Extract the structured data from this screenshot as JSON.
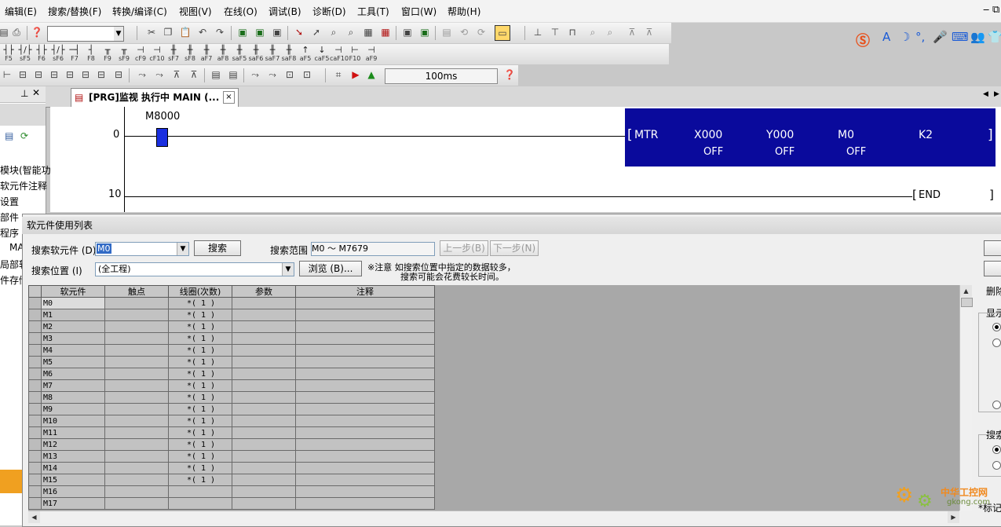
{
  "menu": [
    "编辑(E)",
    "搜索/替换(F)",
    "转换/编译(C)",
    "视图(V)",
    "在线(O)",
    "调试(B)",
    "诊断(D)",
    "工具(T)",
    "窗口(W)",
    "帮助(H)"
  ],
  "function_keys": [
    "F5",
    "sF5",
    "F6",
    "sF6",
    "F7",
    "F8",
    "F9",
    "sF9",
    "cF9",
    "cF10",
    "sF7",
    "sF8",
    "aF7",
    "aF8",
    "saF5",
    "saF6",
    "saF7",
    "saF8",
    "aF5",
    "caF5",
    "caF10",
    "F10",
    "aF9"
  ],
  "toolbar": {
    "monitor_interval": "100ms"
  },
  "left_pane": {
    "items": [
      "模块(智能功",
      "软元件注释",
      "设置",
      "部件",
      "程序",
      "MA",
      "局部软",
      "件存储"
    ]
  },
  "tab": {
    "title": "[PRG]监视 执行中 MAIN (...",
    "close": "×"
  },
  "ladder": {
    "contact_label": "M8000",
    "step0": "0",
    "step10": "10",
    "instruction": {
      "name": "MTR",
      "ops": [
        {
          "label": "X000",
          "value": "OFF"
        },
        {
          "label": "Y000",
          "value": "OFF"
        },
        {
          "label": "M0",
          "value": "OFF"
        },
        {
          "label": "K2",
          "value": ""
        }
      ]
    },
    "end": "END"
  },
  "dialog": {
    "title": "软元件使用列表",
    "search_device_label": "搜索软元件 (D)",
    "search_device_value": "M0",
    "search_button": "搜索",
    "range_label": "搜索范围",
    "range_value": "M0 ～ M7679",
    "prev_button": "上一步(B)",
    "next_button": "下一步(N)",
    "location_label": "搜索位置 (I)",
    "location_value": "(全工程)",
    "browse_button": "浏览 (B)...",
    "note_line1": "※注意  如搜索位置中指定的数据较多，",
    "note_line2": "搜索可能会花费较长时间。",
    "columns": [
      "软元件",
      "触点",
      "线圈(次数)",
      "参数",
      "注释"
    ],
    "rows": [
      {
        "dev": "M0",
        "coil": "*(  1 )"
      },
      {
        "dev": "M1",
        "coil": "*(  1 )"
      },
      {
        "dev": "M2",
        "coil": "*(  1 )"
      },
      {
        "dev": "M3",
        "coil": "*(  1 )"
      },
      {
        "dev": "M4",
        "coil": "*(  1 )"
      },
      {
        "dev": "M5",
        "coil": "*(  1 )"
      },
      {
        "dev": "M6",
        "coil": "*(  1 )"
      },
      {
        "dev": "M7",
        "coil": "*(  1 )"
      },
      {
        "dev": "M8",
        "coil": "*(  1 )"
      },
      {
        "dev": "M9",
        "coil": "*(  1 )"
      },
      {
        "dev": "M10",
        "coil": "*(  1 )"
      },
      {
        "dev": "M11",
        "coil": "*(  1 )"
      },
      {
        "dev": "M12",
        "coil": "*(  1 )"
      },
      {
        "dev": "M13",
        "coil": "*(  1 )"
      },
      {
        "dev": "M14",
        "coil": "*(  1 )"
      },
      {
        "dev": "M15",
        "coil": "*(  1 )"
      },
      {
        "dev": "M16",
        "coil": ""
      },
      {
        "dev": "M17",
        "coil": ""
      }
    ]
  },
  "right_panel": {
    "delete": "删除",
    "display": "显示",
    "search": "搜索",
    "mark": "*标记"
  },
  "watermark": {
    "cn": "中华工控网",
    "url": "gkong.com"
  },
  "colors": {
    "instruction_bg": "#0a0a9c",
    "contact_fill": "#1a2fe0",
    "grid_bg": "#a8a8a8"
  }
}
